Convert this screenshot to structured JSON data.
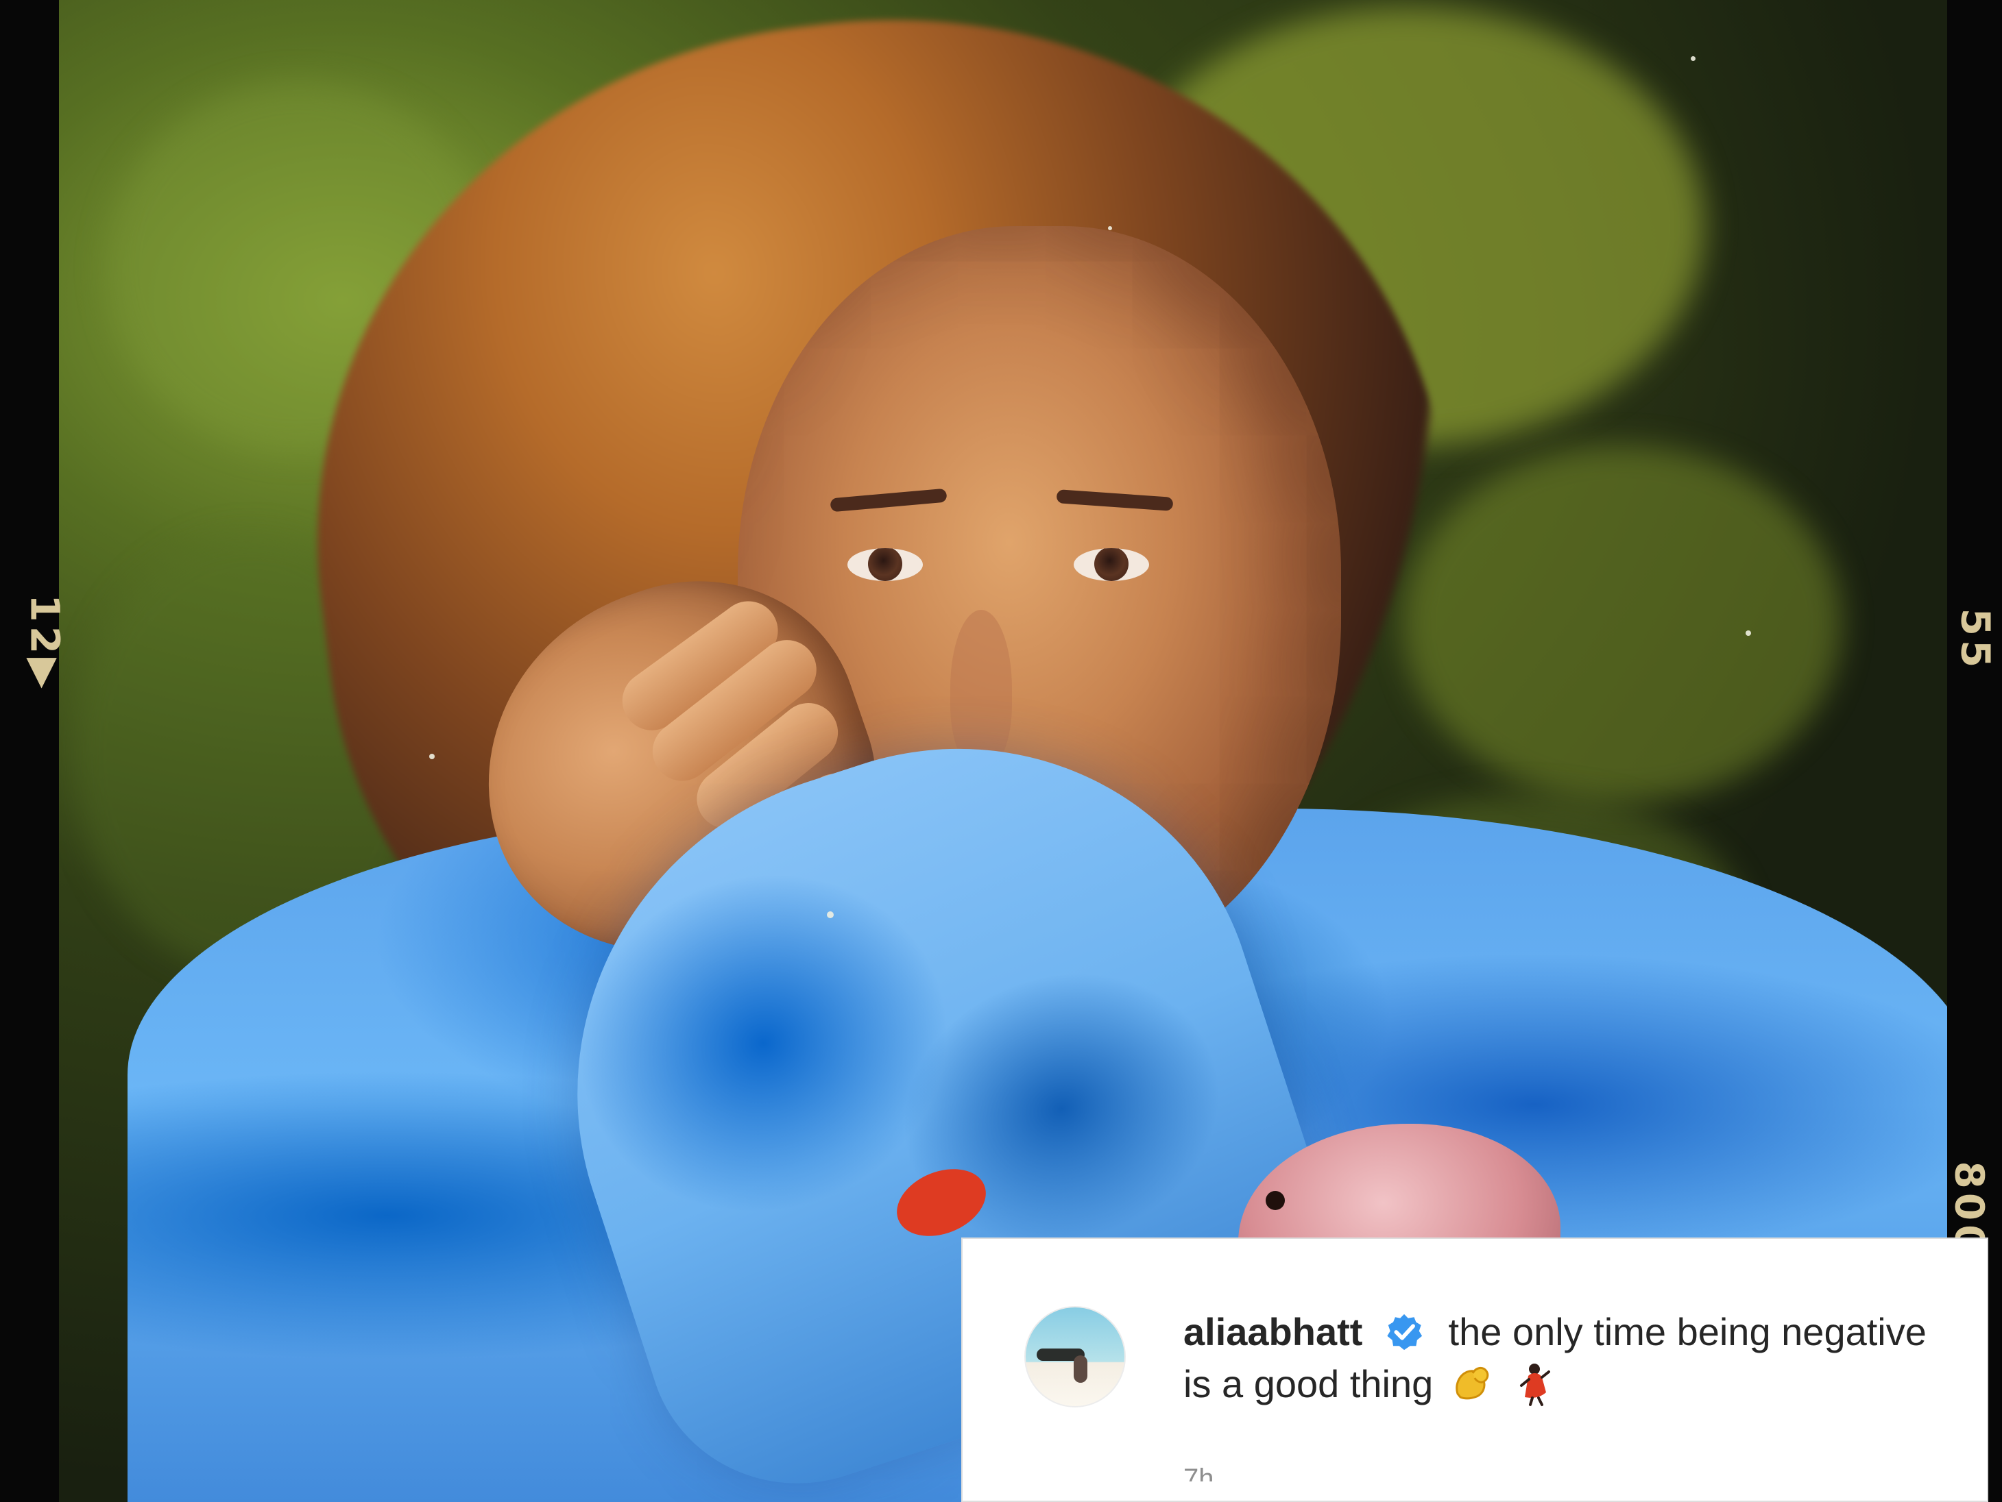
{
  "filmstrip": {
    "left_number": "12▶",
    "right_numbers": [
      "55",
      "800"
    ]
  },
  "comment": {
    "avatar_icon": "profile-avatar",
    "username": "aliaabhatt",
    "verified_icon": "verified-badge-icon",
    "text": "the only time being negative is a good thing",
    "emojis": [
      "flexed-biceps-emoji",
      "woman-dancing-emoji"
    ],
    "timestamp": "7h"
  },
  "colors": {
    "card_background": "#ffffff",
    "username": "#262626",
    "timestamp": "#8e8e8e",
    "verified_badge": "#3897f0"
  }
}
